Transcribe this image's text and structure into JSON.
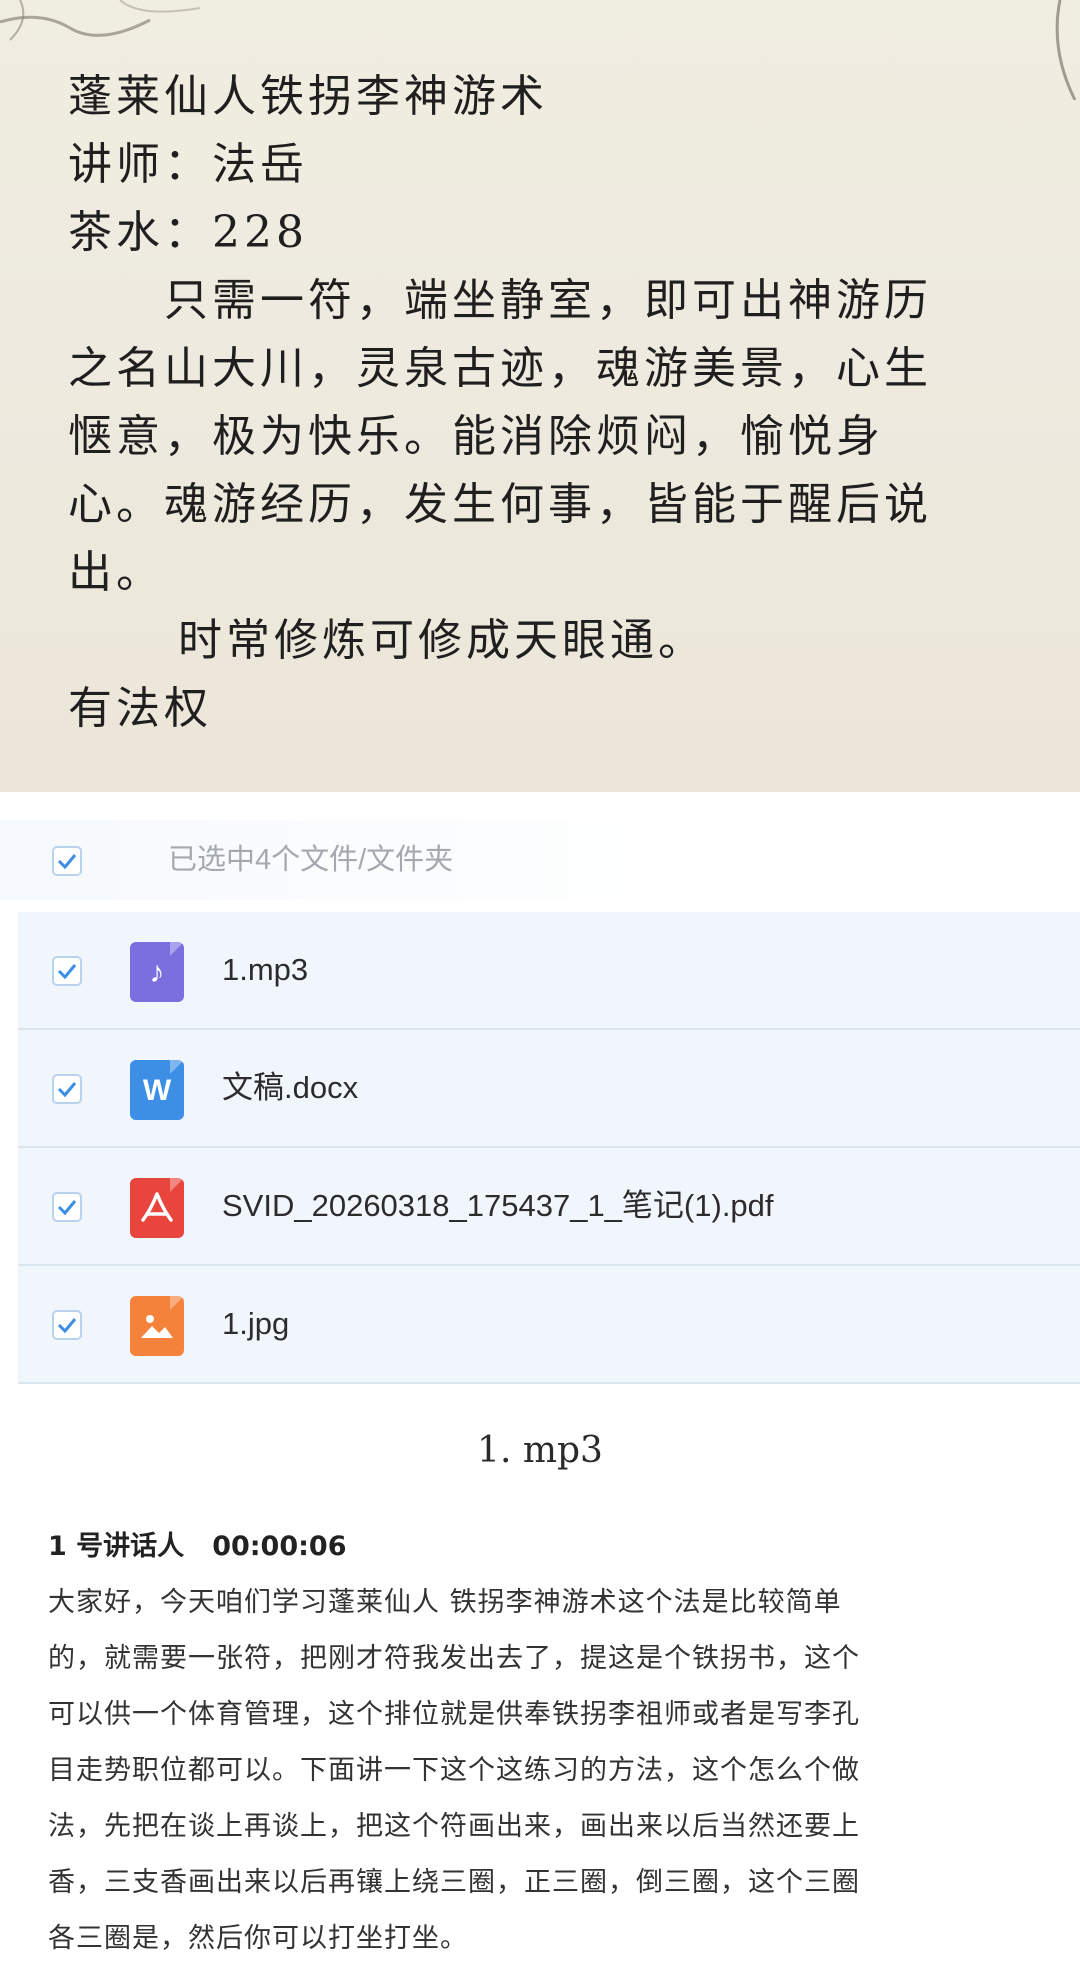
{
  "poster": {
    "title": "蓬莱仙人铁拐李神游术",
    "lecturer": "讲师：法岳",
    "fee": "茶水：228",
    "body_lines": [
      "　　只需一符，端坐静室，即可出神游历",
      "之名山大川，灵泉古迹，魂游美景，心生",
      "惬意，极为快乐。能消除烦闷，愉悦身",
      "心。魂游经历，发生何事，皆能于醒后说",
      "出。"
    ],
    "practice_line": "　　时常修炼可修成天眼通。",
    "rights": "有法权"
  },
  "file_list": {
    "selection_text": "已选中4个文件/文件夹",
    "files": [
      {
        "name": "1.mp3",
        "icon": "music-file-icon",
        "color": "#7b6fe0",
        "glyph": "♪"
      },
      {
        "name": "文稿.docx",
        "icon": "word-file-icon",
        "color": "#3d8fe6",
        "glyph": "W"
      },
      {
        "name": "SVID_20260318_175437_1_笔记(1).pdf",
        "icon": "pdf-file-icon",
        "color": "#e8453c",
        "glyph": "⋏"
      },
      {
        "name": "1.jpg",
        "icon": "image-file-icon",
        "color": "#f5823a",
        "glyph": "▲"
      }
    ]
  },
  "transcript": {
    "title": "1. mp3",
    "speaker": "1 号讲话人",
    "timestamp": "00:00:06",
    "lines": [
      "大家好，今天咱们学习蓬莱仙人 铁拐李神游术这个法是比较简单",
      "的，就需要一张符，把刚才符我发出去了，提这是个铁拐书，这个",
      "可以供一个体育管理，这个排位就是供奉铁拐李祖师或者是写李孔",
      "目走势职位都可以。下面讲一下这个这练习的方法，这个怎么个做",
      "法，先把在谈上再谈上，把这个符画出来，画出来以后当然还要上",
      "香，三支香画出来以后再镶上绕三圈，正三圈，倒三圈，这个三圈",
      "各三圈是，然后你可以打坐打坐。"
    ]
  },
  "colors": {
    "paper": "#eeeadf",
    "row_bg": "#f1f6fc",
    "checkbox_blue": "#3a8ee6"
  }
}
